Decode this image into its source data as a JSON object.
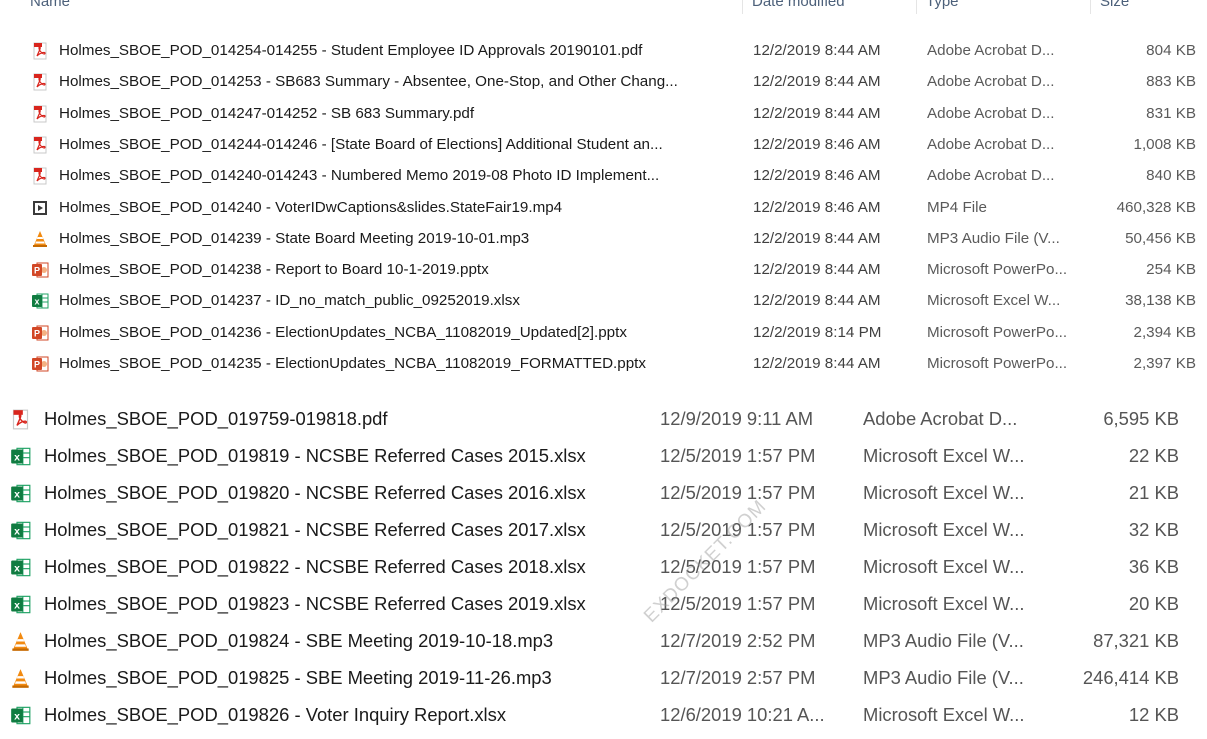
{
  "header": {
    "columns": [
      "Name",
      "Date modified",
      "Type",
      "Size"
    ]
  },
  "group1": [
    {
      "icon": "pdf-icon",
      "name": "Holmes_SBOE_POD_014254-014255 - Student Employee ID Approvals 20190101.pdf",
      "date": "12/2/2019 8:44 AM",
      "type": "Adobe Acrobat D...",
      "size": "804 KB"
    },
    {
      "icon": "pdf-icon",
      "name": "Holmes_SBOE_POD_014253 - SB683 Summary - Absentee, One-Stop, and Other Chang...",
      "date": "12/2/2019 8:44 AM",
      "type": "Adobe Acrobat D...",
      "size": "883 KB"
    },
    {
      "icon": "pdf-icon",
      "name": "Holmes_SBOE_POD_014247-014252 - SB 683 Summary.pdf",
      "date": "12/2/2019 8:44 AM",
      "type": "Adobe Acrobat D...",
      "size": "831 KB"
    },
    {
      "icon": "pdf-icon",
      "name": "Holmes_SBOE_POD_014244-014246 - [State Board of Elections] Additional Student an...",
      "date": "12/2/2019 8:46 AM",
      "type": "Adobe Acrobat D...",
      "size": "1,008 KB"
    },
    {
      "icon": "pdf-icon",
      "name": "Holmes_SBOE_POD_014240-014243 - Numbered Memo 2019-08 Photo ID Implement...",
      "date": "12/2/2019 8:46 AM",
      "type": "Adobe Acrobat D...",
      "size": "840 KB"
    },
    {
      "icon": "video-icon",
      "name": "Holmes_SBOE_POD_014240 - VoterIDwCaptions&slides.StateFair19.mp4",
      "date": "12/2/2019 8:46 AM",
      "type": "MP4 File",
      "size": "460,328 KB"
    },
    {
      "icon": "vlc-icon",
      "name": "Holmes_SBOE_POD_014239 - State Board Meeting 2019-10-01.mp3",
      "date": "12/2/2019 8:44 AM",
      "type": "MP3 Audio File (V...",
      "size": "50,456 KB"
    },
    {
      "icon": "powerpoint-icon",
      "name": "Holmes_SBOE_POD_014238 - Report to Board 10-1-2019.pptx",
      "date": "12/2/2019 8:44 AM",
      "type": "Microsoft PowerPo...",
      "size": "254 KB"
    },
    {
      "icon": "excel-icon",
      "name": "Holmes_SBOE_POD_014237 - ID_no_match_public_09252019.xlsx",
      "date": "12/2/2019 8:44 AM",
      "type": "Microsoft Excel W...",
      "size": "38,138 KB"
    },
    {
      "icon": "powerpoint-icon",
      "name": "Holmes_SBOE_POD_014236 - ElectionUpdates_NCBA_11082019_Updated[2].pptx",
      "date": "12/2/2019 8:14 PM",
      "type": "Microsoft PowerPo...",
      "size": "2,394 KB"
    },
    {
      "icon": "powerpoint-icon",
      "name": "Holmes_SBOE_POD_014235 - ElectionUpdates_NCBA_11082019_FORMATTED.pptx",
      "date": "12/2/2019 8:44 AM",
      "type": "Microsoft PowerPo...",
      "size": "2,397 KB"
    }
  ],
  "group2": [
    {
      "icon": "pdf-icon",
      "name": "Holmes_SBOE_POD_019759-019818.pdf",
      "date": "12/9/2019 9:11 AM",
      "type": "Adobe Acrobat D...",
      "size": "6,595 KB"
    },
    {
      "icon": "excel-icon",
      "name": "Holmes_SBOE_POD_019819 - NCSBE Referred Cases 2015.xlsx",
      "date": "12/5/2019 1:57 PM",
      "type": "Microsoft Excel W...",
      "size": "22 KB"
    },
    {
      "icon": "excel-icon",
      "name": "Holmes_SBOE_POD_019820 - NCSBE Referred Cases 2016.xlsx",
      "date": "12/5/2019 1:57 PM",
      "type": "Microsoft Excel W...",
      "size": "21 KB"
    },
    {
      "icon": "excel-icon",
      "name": "Holmes_SBOE_POD_019821 - NCSBE Referred Cases 2017.xlsx",
      "date": "12/5/2019 1:57 PM",
      "type": "Microsoft Excel W...",
      "size": "32 KB"
    },
    {
      "icon": "excel-icon",
      "name": "Holmes_SBOE_POD_019822 - NCSBE Referred Cases 2018.xlsx",
      "date": "12/5/2019 1:57 PM",
      "type": "Microsoft Excel W...",
      "size": "36 KB"
    },
    {
      "icon": "excel-icon",
      "name": "Holmes_SBOE_POD_019823 - NCSBE Referred Cases 2019.xlsx",
      "date": "12/5/2019 1:57 PM",
      "type": "Microsoft Excel W...",
      "size": "20 KB"
    },
    {
      "icon": "vlc-icon",
      "name": "Holmes_SBOE_POD_019824 - SBE Meeting 2019-10-18.mp3",
      "date": "12/7/2019 2:52 PM",
      "type": "MP3 Audio File (V...",
      "size": "87,321 KB"
    },
    {
      "icon": "vlc-icon",
      "name": "Holmes_SBOE_POD_019825 - SBE Meeting 2019-11-26.mp3",
      "date": "12/7/2019 2:57 PM",
      "type": "MP3 Audio File (V...",
      "size": "246,414 KB"
    },
    {
      "icon": "excel-icon",
      "name": "Holmes_SBOE_POD_019826 - Voter Inquiry Report.xlsx",
      "date": "12/6/2019 10:21 A...",
      "type": "Microsoft Excel W...",
      "size": "12 KB"
    }
  ],
  "watermark": "EXDOCKET.COM"
}
